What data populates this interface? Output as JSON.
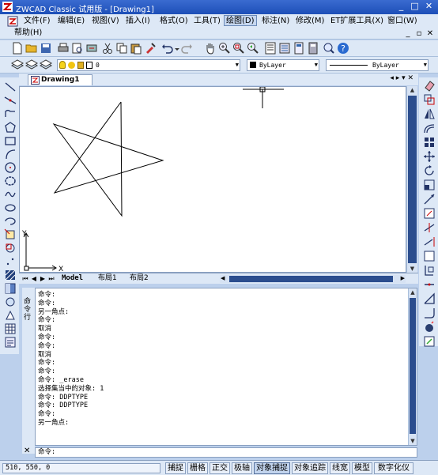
{
  "window": {
    "title": "ZWCAD Classic 试用版 - [Drawing1]",
    "minimize": "_",
    "maximize": "□",
    "close": "✕"
  },
  "menu": {
    "items": [
      "文件(F)",
      "编辑(E)",
      "视图(V)",
      "插入(I)",
      "格式(O)",
      "工具(T)",
      "绘图(D)",
      "标注(N)",
      "修改(M)",
      "ET扩展工具(X)",
      "窗口(W)"
    ],
    "active": "绘图(D)",
    "help": "帮助(H)",
    "doc_min": "_",
    "doc_restore": "▫",
    "doc_close": "✕"
  },
  "properties": {
    "layer": "0",
    "color": "ByLayer",
    "linetype": "ByLayer"
  },
  "document": {
    "tab": "Drawing1",
    "nav": "◂ ▸ ▾ ✕"
  },
  "canvas": {
    "x_label": "X",
    "y_label": "Y"
  },
  "layouts": {
    "nav": [
      "⏮",
      "◀",
      "▶",
      "⏭"
    ],
    "tabs": [
      "Model",
      "布局1",
      "布局2"
    ]
  },
  "command": {
    "panel_label": "命令行",
    "history": [
      "命令:",
      "命令:",
      "另一角点:",
      "命令:",
      "取消",
      "命令:",
      "命令:",
      "取消",
      "命令:",
      "命令:",
      "命令: _erase",
      "选择集当中的对象: 1",
      "命令: DDPTYPE",
      "命令: DDPTYPE",
      "命令:",
      "另一角点:"
    ],
    "prompt": "命令:",
    "close": "✕"
  },
  "status": {
    "coords": "510, 550, 0",
    "buttons": [
      "捕捉",
      "栅格",
      "正交",
      "极轴",
      "对象捕捉",
      "对象追踪",
      "线宽",
      "模型",
      "数字化仪"
    ],
    "on_buttons": [
      "对象捕捉"
    ]
  },
  "colors": {
    "title": "#1d4fb8",
    "chrome": "#dde8f6",
    "scroll_thumb": "#2b4d8e"
  }
}
